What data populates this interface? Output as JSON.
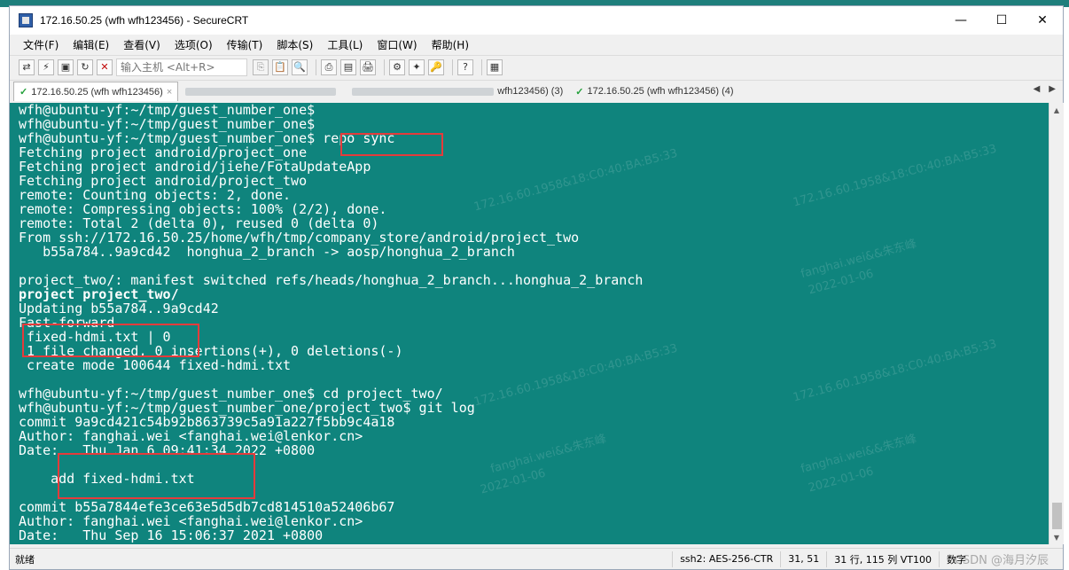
{
  "window": {
    "title": "172.16.50.25 (wfh wfh123456) - SecureCRT",
    "controls": {
      "minimize": "—",
      "maximize": "☐",
      "close": "✕"
    }
  },
  "menu": [
    "文件(F)",
    "编辑(E)",
    "查看(V)",
    "选项(O)",
    "传输(T)",
    "脚本(S)",
    "工具(L)",
    "窗口(W)",
    "帮助(H)"
  ],
  "toolbar": {
    "host_placeholder": "输入主机 <Alt+R>"
  },
  "tabs": {
    "active": "172.16.50.25 (wfh wfh123456)",
    "last": "172.16.50.25 (wfh wfh123456) (4)",
    "partial": "wfh123456) (3)"
  },
  "terminal": {
    "lines": [
      "wfh@ubuntu-yf:~/tmp/guest_number_one$",
      "wfh@ubuntu-yf:~/tmp/guest_number_one$",
      "wfh@ubuntu-yf:~/tmp/guest_number_one$ repo sync",
      "Fetching project android/project_one",
      "Fetching project android/jiehe/FotaUpdateApp",
      "Fetching project android/project_two",
      "remote: Counting objects: 2, done.",
      "remote: Compressing objects: 100% (2/2), done.",
      "remote: Total 2 (delta 0), reused 0 (delta 0)",
      "From ssh://172.16.50.25/home/wfh/tmp/company_store/android/project_two",
      "   b55a784..9a9cd42  honghua_2_branch -> aosp/honghua_2_branch",
      "",
      "project_two/: manifest switched refs/heads/honghua_2_branch...honghua_2_branch",
      "project project_two/",
      "Updating b55a784..9a9cd42",
      "Fast-forward",
      " fixed-hdmi.txt | 0",
      " 1 file changed, 0 insertions(+), 0 deletions(-)",
      " create mode 100644 fixed-hdmi.txt",
      "",
      "wfh@ubuntu-yf:~/tmp/guest_number_one$ cd project_two/",
      "wfh@ubuntu-yf:~/tmp/guest_number_one/project_two$ git log",
      "commit 9a9cd421c54b92b863739c5a91a227f5bb9c4a18",
      "Author: fanghai.wei <fanghai.wei@lenkor.cn>",
      "Date:   Thu Jan 6 09:41:34 2022 +0800",
      "",
      "    add fixed-hdmi.txt",
      "",
      "commit b55a7844efe3ce63e5d5db7cd814510a52406b67",
      "Author: fanghai.wei <fanghai.wei@lenkor.cn>",
      "Date:   Thu Sep 16 15:06:37 2021 +0800"
    ],
    "bold_line": 13,
    "colors": {
      "background": "#0f847d",
      "foreground": "#ffffff",
      "highlight": "#e53b3b"
    }
  },
  "status": {
    "ready": "就绪",
    "cipher": "ssh2: AES-256-CTR",
    "cursor": "31, 51",
    "size": "31 行, 115 列 VT100",
    "mode": "数字"
  },
  "watermark": {
    "csdn": "CSDN @海月汐辰"
  }
}
